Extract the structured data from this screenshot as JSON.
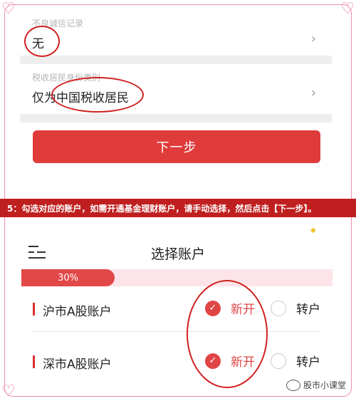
{
  "form": {
    "record_label": "不良诚信记录",
    "record_value": "无",
    "tax_label": "税收居民身份类别",
    "tax_value": "仅为中国税收居民",
    "next_button": "下一步"
  },
  "banner_text": "5：勾选对应的账户，如需开通基金理财账户，请手动选择，然后点击【下一步】。",
  "screen": {
    "title": "选择账户",
    "progress_label": "30%",
    "progress": 0.3
  },
  "accounts": [
    {
      "name": "沪市A股账户",
      "new_label": "新开",
      "new_checked": true,
      "transfer_label": "转户",
      "transfer_checked": false
    },
    {
      "name": "深市A股账户",
      "new_label": "新开",
      "new_checked": true,
      "transfer_label": "转户",
      "transfer_checked": false
    }
  ],
  "watermark": "股市小课堂",
  "colors": {
    "accent": "#e03b3b",
    "banner": "#c01f1f",
    "frame": "#f08fb4"
  },
  "icons": {
    "chevron": "chevron-right-icon",
    "menu": "menu-icon",
    "check": "check-icon"
  }
}
